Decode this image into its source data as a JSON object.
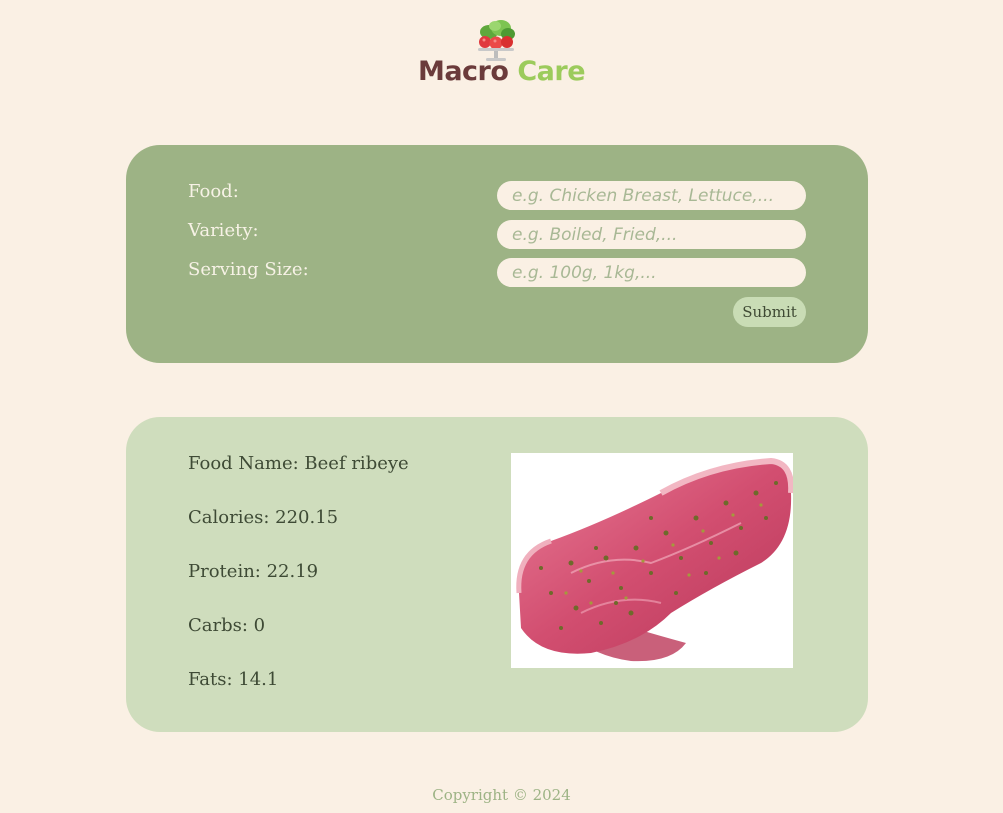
{
  "brand": {
    "name_part1": "Macro",
    "name_part2": "Care",
    "colors": {
      "part1": "#6B3B3B",
      "part2": "#9CCB5C"
    },
    "icon": "salad-bowl-icon"
  },
  "search_form": {
    "food_label": "Food:",
    "food_placeholder": "e.g. Chicken Breast, Lettuce,...",
    "variety_label": "Variety:",
    "variety_placeholder": "e.g. Boiled, Fried,...",
    "serving_label": "Serving Size:",
    "serving_placeholder": "e.g. 100g, 1kg,...",
    "submit_label": "Submit"
  },
  "result": {
    "food_name": "Food Name: Beef ribeye",
    "calories": "Calories: 220.15",
    "protein": "Protein: 22.19",
    "carbs": "Carbs: 0",
    "fats": "Fats: 14.1",
    "image_subject": "raw-seasoned-beef-steak"
  },
  "footer": {
    "copyright": "Copyright © 2024"
  },
  "theme": {
    "background": "#FAF0E4",
    "search_card": "#9DB385",
    "result_card": "#CFDDBD"
  }
}
